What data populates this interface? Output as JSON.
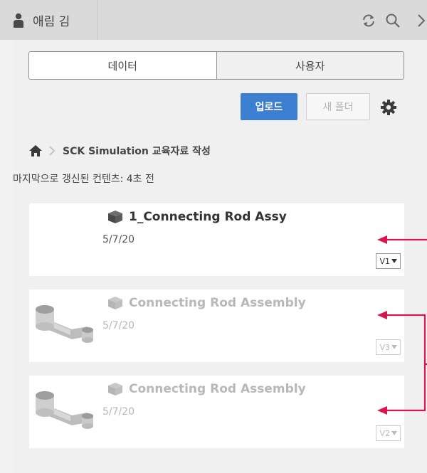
{
  "header": {
    "user_name": "애림 김",
    "icons": [
      "user-icon",
      "refresh-icon",
      "search-icon",
      "close-icon"
    ]
  },
  "tabs": [
    {
      "label": "데이터",
      "active": true
    },
    {
      "label": "사용자",
      "active": false
    }
  ],
  "actions": {
    "upload_label": "업로드",
    "new_folder_label": "새 폴더",
    "settings_icon": "gear-icon"
  },
  "breadcrumb": {
    "home_icon": "home-icon",
    "folder": "SCK Simulation 교육자료 작성"
  },
  "status": {
    "last_updated": "마지막으로 갱신된 컨텐츠: 4초 전"
  },
  "items": [
    {
      "title": "1_Connecting Rod Assy",
      "date": "5/7/20",
      "version": "V1",
      "dimmed": false
    },
    {
      "title": "Connecting Rod Assembly",
      "date": "5/7/20",
      "version": "V3",
      "dimmed": true
    },
    {
      "title": "Connecting Rod Assembly",
      "date": "5/7/20",
      "version": "V2",
      "dimmed": true
    }
  ],
  "colors": {
    "accent": "#3c7fd1",
    "annotation": "#d6174f",
    "header_bg": "#dadada"
  }
}
